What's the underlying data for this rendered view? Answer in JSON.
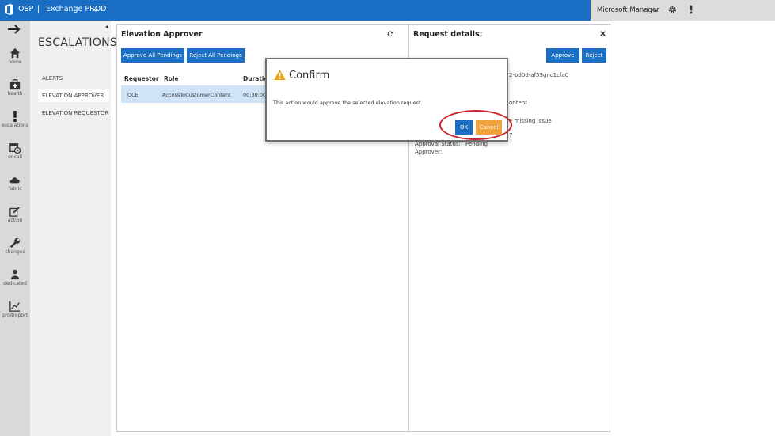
{
  "topbar": {
    "app_name": "OSP",
    "separator": "|",
    "environment": "Exchange PROD",
    "user": "Microsoft Manager"
  },
  "rail": [
    {
      "label": "home",
      "icon": "home-icon"
    },
    {
      "label": "health",
      "icon": "medkit-icon"
    },
    {
      "label": "escalations",
      "icon": "exclamation-icon"
    },
    {
      "label": "oncall",
      "icon": "calendar-clock-icon"
    },
    {
      "label": "fabric",
      "icon": "cloud-icon"
    },
    {
      "label": "action",
      "icon": "edit-icon"
    },
    {
      "label": "changes",
      "icon": "wrench-icon"
    },
    {
      "label": "dedicated",
      "icon": "users-icon"
    },
    {
      "label": "prodreport",
      "icon": "chart-icon"
    }
  ],
  "subnav": {
    "title": "ESCALATIONS",
    "items": [
      "ALERTS",
      "ELEVATION APPROVER",
      "ELEVATION REQUESTOR"
    ]
  },
  "approver": {
    "title": "Elevation Approver",
    "approve_all": "Approve All Pendings",
    "reject_all": "Reject All Pendings",
    "columns": [
      "Requestor",
      "Role",
      "Duration"
    ],
    "rows": [
      {
        "requestor": "OCE",
        "role": "AccessToCustomerContent",
        "duration": "00:30:00"
      }
    ]
  },
  "details": {
    "title": "Request details:",
    "approve": "Approve",
    "reject": "Reject",
    "fragments": [
      "2-bd0d-af53gnc1cfa0",
      "ontent",
      "e missing issue",
      "7"
    ],
    "approval_status_label": "Approval Status:",
    "approval_status_value": "Pending",
    "approver_label": "Approver:"
  },
  "modal": {
    "title": "Confirm",
    "message": "This action would approve the selected elevation request.",
    "ok": "OK",
    "cancel": "Cancel"
  },
  "colors": {
    "accent": "#1a6fc4",
    "cancel": "#f0a23c",
    "warning": "#e8a317",
    "highlight": "#c8232b"
  }
}
